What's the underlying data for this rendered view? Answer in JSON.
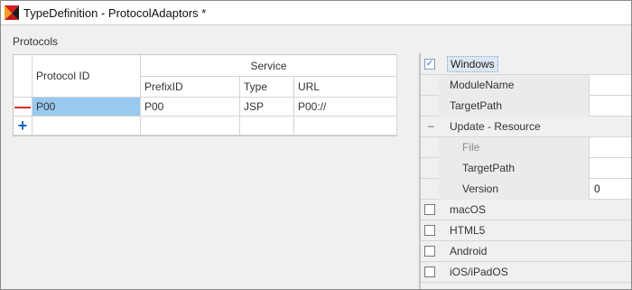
{
  "window": {
    "title": "TypeDefinition - ProtocolAdaptors *"
  },
  "protocols": {
    "section_label": "Protocols",
    "headers": {
      "protocol_id": "Protocol ID",
      "service": "Service",
      "prefix_id": "PrefixID",
      "type": "Type",
      "url": "URL"
    },
    "rows": [
      {
        "protocol_id": "P00",
        "prefix_id": "P00",
        "type": "JSP",
        "url": "P00://"
      }
    ],
    "remove_glyph": "—",
    "add_glyph": "+"
  },
  "platforms": {
    "windows": {
      "label": "Windows",
      "checked": true,
      "check_glyph": "✓",
      "properties": [
        {
          "name": "ModuleName",
          "value": ""
        },
        {
          "name": "TargetPath",
          "value": ""
        }
      ],
      "update_resource": {
        "label": "Update - Resource",
        "collapse_glyph": "–",
        "properties": [
          {
            "name": "File",
            "value": ""
          },
          {
            "name": "TargetPath",
            "value": ""
          },
          {
            "name": "Version",
            "value": "0"
          }
        ]
      }
    },
    "others": [
      {
        "label": "macOS",
        "checked": false
      },
      {
        "label": "HTML5",
        "checked": false
      },
      {
        "label": "Android",
        "checked": false
      },
      {
        "label": "iOS/iPadOS",
        "checked": false
      }
    ]
  },
  "colors": {
    "selection": "#99c9ef",
    "remove_icon": "#d42020",
    "add_icon": "#1a66c8"
  }
}
